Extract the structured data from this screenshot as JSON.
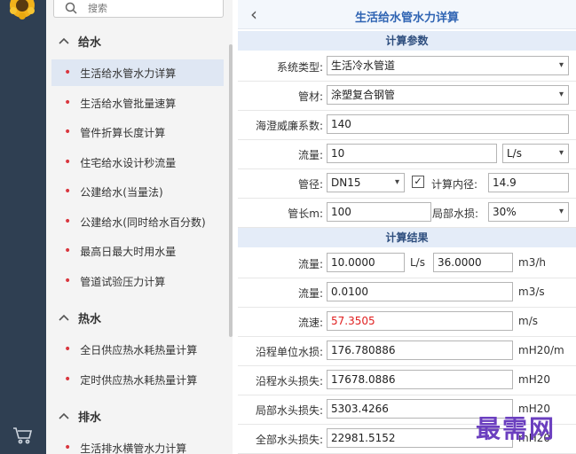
{
  "search": {
    "placeholder": "搜索"
  },
  "sidebar": {
    "sections": [
      {
        "label": "给水",
        "items": [
          "生活给水管水力详算",
          "生活给水管批量速算",
          "管件折算长度计算",
          "住宅给水设计秒流量",
          "公建给水(当量法)",
          "公建给水(同时给水百分数)",
          "最高日最大时用水量",
          "管道试验压力计算"
        ]
      },
      {
        "label": "热水",
        "items": [
          "全日供应热水耗热量计算",
          "定时供应热水耗热量计算"
        ]
      },
      {
        "label": "排水",
        "items": [
          "生活排水横管水力计算"
        ]
      }
    ]
  },
  "header": {
    "title": "生活给水管水力详算",
    "back_glyph": "‹"
  },
  "params": {
    "band": "计算参数",
    "system_type_label": "系统类型:",
    "system_type_value": "生活冷水管道",
    "material_label": "管材:",
    "material_value": "涂塑复合钢管",
    "hw_label": "海澄威廉系数:",
    "hw_value": "140",
    "flow_label": "流量:",
    "flow_value": "10",
    "flow_unit": "L/s",
    "dia_label": "管径:",
    "dia_value": "DN15",
    "inner_check": "✓",
    "inner_label": "计算内径:",
    "inner_value": "14.9",
    "len_label": "管长m:",
    "len_value": "100",
    "local_label": "局部水损:",
    "local_value": "30%"
  },
  "results": {
    "band": "计算结果",
    "flow1_label": "流量:",
    "flow1_value": "10.0000",
    "flow1_unit": "L/s",
    "flow1_value2": "36.0000",
    "flow1_unit2": "m3/h",
    "flow2_label": "流量:",
    "flow2_value": "0.0100",
    "flow2_unit": "m3/s",
    "vel_label": "流速:",
    "vel_value": "57.3505",
    "vel_unit": "m/s",
    "unit_loss_label": "沿程单位水损:",
    "unit_loss_value": "176.780886",
    "unit_loss_unit": "mH20/m",
    "head_loss_label": "沿程水头损失:",
    "head_loss_value": "17678.0886",
    "head_loss_unit": "mH20",
    "local_loss_label": "局部水头损失:",
    "local_loss_value": "5303.4266",
    "local_loss_unit": "mH20",
    "total_loss_label": "全部水头损失:",
    "total_loss_value": "22981.5152",
    "total_loss_unit": "mH20"
  },
  "watermark": "最需网",
  "colors": {
    "rail": "#2f3f52",
    "title": "#2f64b3",
    "band": "#e4ecf8",
    "velocity": "#e02020",
    "dot": "#d9363e"
  }
}
